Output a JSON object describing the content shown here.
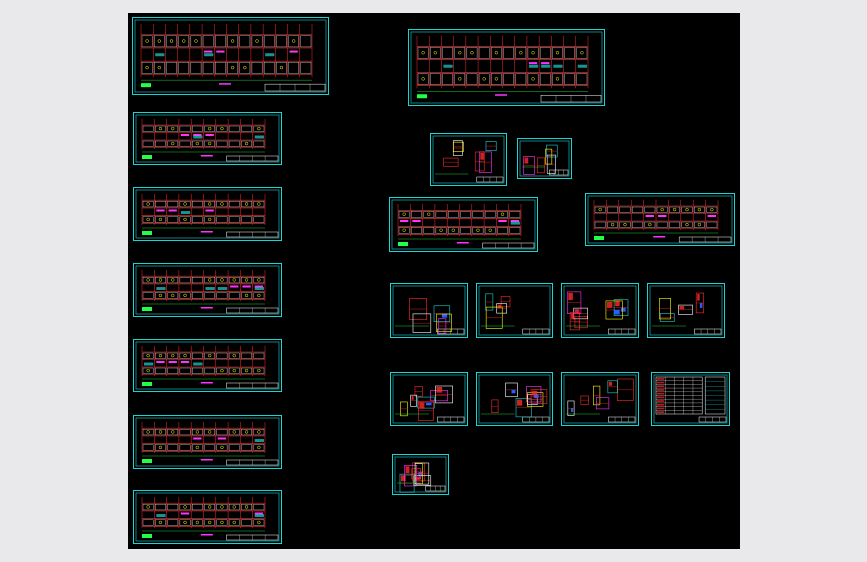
{
  "app": {
    "view": "cad-model-space",
    "background_color": "#000000",
    "frame_color": "#19d4d4"
  },
  "palette": {
    "red": "#ff2a2a",
    "cyan": "#19d4d4",
    "white": "#ffffff",
    "yellow": "#ffff00",
    "green": "#22ff44",
    "magenta": "#ff33ff",
    "blue": "#2b5cff"
  },
  "sheets": [
    {
      "id": "plan-a-1",
      "kind": "plan"
    },
    {
      "id": "plan-a-2",
      "kind": "plan"
    },
    {
      "id": "plan-a-3",
      "kind": "plan"
    },
    {
      "id": "plan-a-4",
      "kind": "plan"
    },
    {
      "id": "plan-a-5",
      "kind": "plan"
    },
    {
      "id": "plan-a-6",
      "kind": "plan"
    },
    {
      "id": "plan-a-7",
      "kind": "plan"
    },
    {
      "id": "plan-b-1",
      "kind": "plan"
    },
    {
      "id": "detail-1",
      "kind": "detail"
    },
    {
      "id": "detail-2",
      "kind": "detail"
    },
    {
      "id": "plan-b-2",
      "kind": "plan"
    },
    {
      "id": "plan-b-3",
      "kind": "plan"
    },
    {
      "id": "detail-row1-1",
      "kind": "detail"
    },
    {
      "id": "detail-row1-2",
      "kind": "detail"
    },
    {
      "id": "detail-row1-3",
      "kind": "detail"
    },
    {
      "id": "detail-row1-4",
      "kind": "detail"
    },
    {
      "id": "detail-row2-1",
      "kind": "detail"
    },
    {
      "id": "detail-row2-2",
      "kind": "detail"
    },
    {
      "id": "detail-row2-3",
      "kind": "detail"
    },
    {
      "id": "schedule-table",
      "kind": "table"
    },
    {
      "id": "detail-row3-1",
      "kind": "detail"
    }
  ]
}
